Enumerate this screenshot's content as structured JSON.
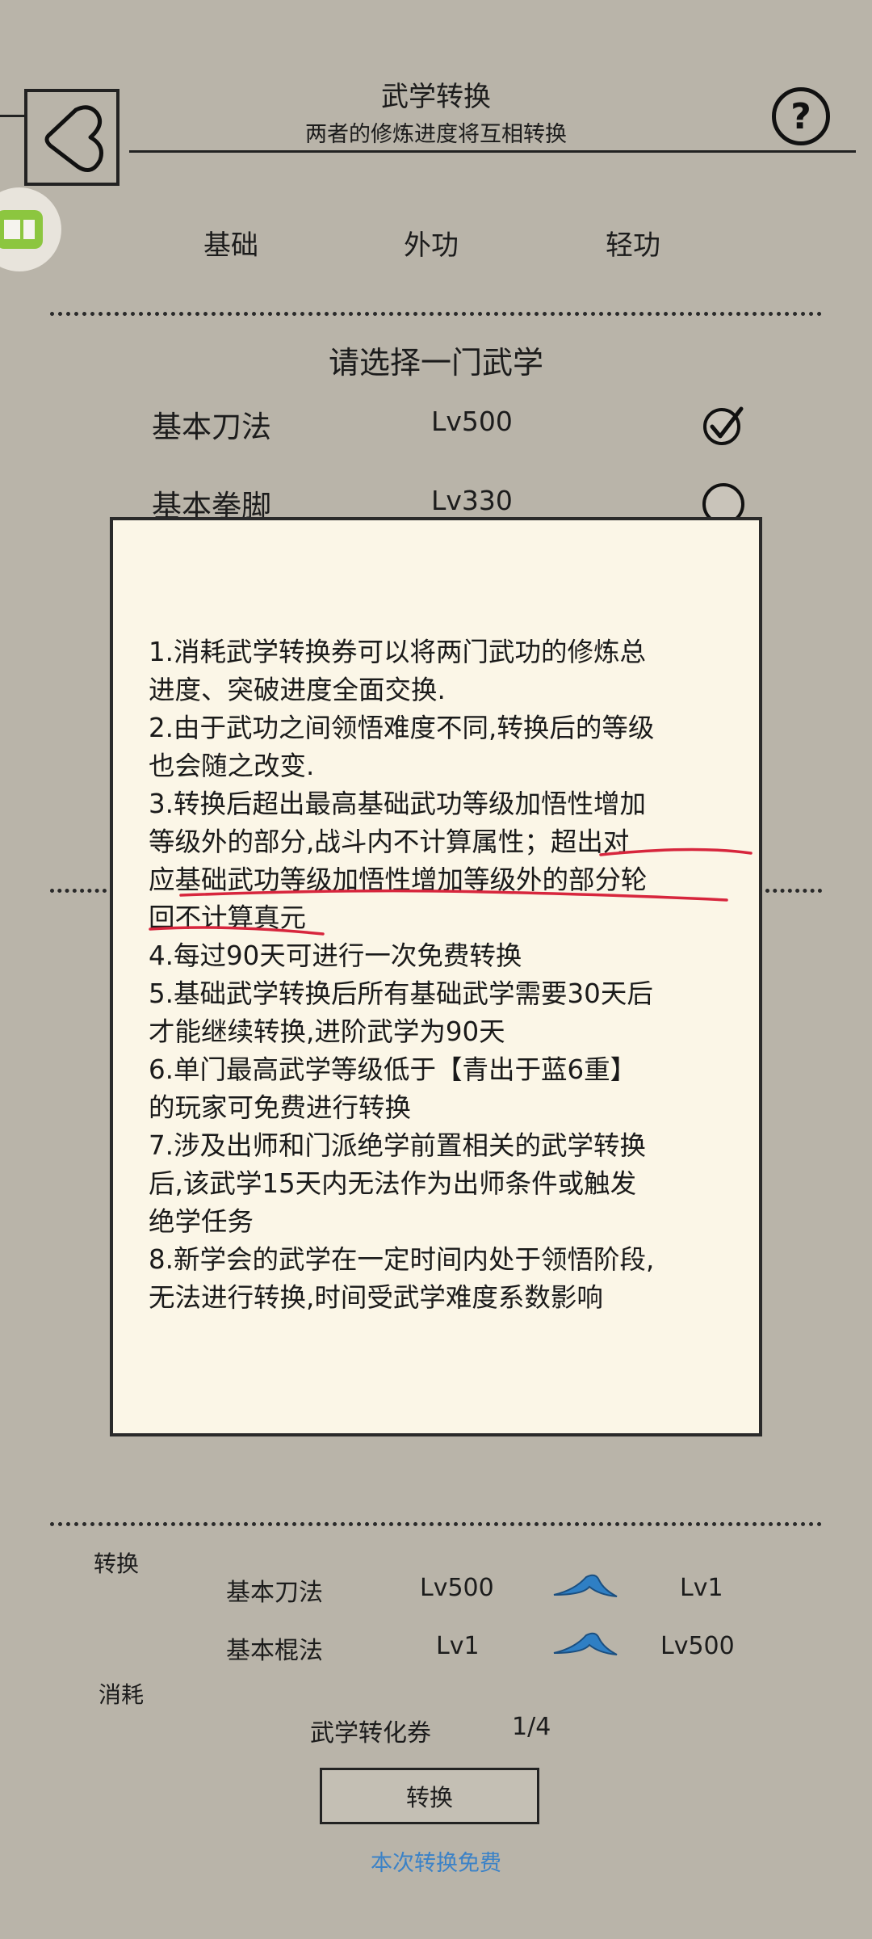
{
  "header": {
    "title": "武学转换",
    "subtitle": "两者的修炼进度将互相转换",
    "help_symbol": "?"
  },
  "tabs": [
    "基础",
    "外功",
    "轻功"
  ],
  "select_prompt": "请选择一门武学",
  "skills": [
    {
      "name": "基本刀法",
      "level": "Lv500",
      "selected": true
    },
    {
      "name": "基本拳脚",
      "level": "Lv330",
      "selected": false
    }
  ],
  "modal": {
    "lines": [
      "1.消耗武学转换券可以将两门武功的修炼总",
      "进度、突破进度全面交换.",
      "2.由于武功之间领悟难度不同,转换后的等级",
      "也会随之改变.",
      "3.转换后超出最高基础武功等级加悟性增加",
      "等级外的部分,战斗内不计算属性；超出对",
      "应基础武功等级加悟性增加等级外的部分轮",
      "回不计算真元",
      "4.每过90天可进行一次免费转换",
      "5.基础武学转换后所有基础武学需要30天后",
      "才能继续转换,进阶武学为90天",
      "6.单门最高武学等级低于【青出于蓝6重】",
      "的玩家可免费进行转换",
      "7.涉及出师和门派绝学前置相关的武学转换",
      "后,该武学15天内无法作为出师条件或触发",
      "绝学任务",
      "8.新学会的武学在一定时间内处于领悟阶段,",
      "无法进行转换,时间受武学难度系数影响"
    ]
  },
  "conversion": {
    "label": "转换",
    "rows": [
      {
        "from_name": "基本刀法",
        "from_level": "Lv500",
        "to_level": "Lv1"
      },
      {
        "from_name": "基本棍法",
        "from_level": "Lv1",
        "to_level": "Lv500"
      }
    ]
  },
  "cost": {
    "label": "消耗",
    "item": "武学转化券",
    "count": "1/4"
  },
  "convert_button": "转换",
  "free_note": "本次转换免费",
  "colors": {
    "background": "#b9b4a9",
    "modal": "#fbf6e7",
    "highlight_underline": "#d7263d",
    "arrow": "#2f7fc4",
    "free_note": "#3b82c7"
  }
}
